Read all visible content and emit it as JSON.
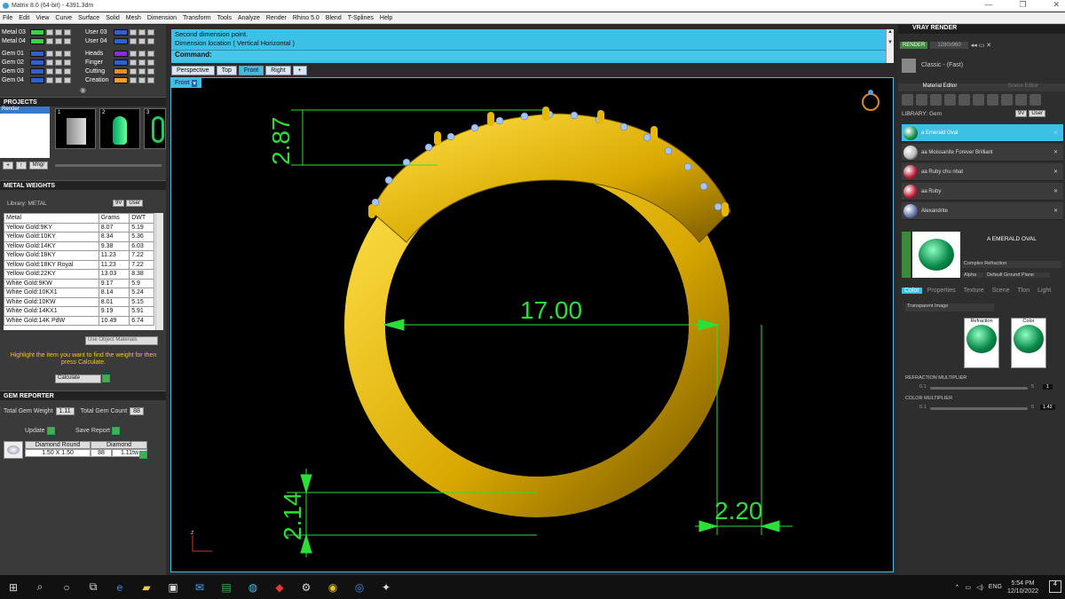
{
  "window": {
    "title": "Matrix 8.0 (64-bit) - 4391.3dm",
    "controls": [
      "—",
      "❐",
      "✕"
    ]
  },
  "menu": [
    "File",
    "Edit",
    "View",
    "Curve",
    "Surface",
    "Solid",
    "Mesh",
    "Dimension",
    "Transform",
    "Tools",
    "Analyze",
    "Render",
    "Rhino 5.0",
    "Blend",
    "T-Splines",
    "Help"
  ],
  "layers": {
    "left": [
      {
        "name": "Metal 03",
        "color": "#3ccf4e"
      },
      {
        "name": "Metal 04",
        "color": "#3ccf4e"
      },
      {
        "name": "Gem 01",
        "color": "#2f5fd0"
      },
      {
        "name": "Gem 02",
        "color": "#2f5fd0"
      },
      {
        "name": "Gem 03",
        "color": "#2f5fd0"
      },
      {
        "name": "Gem 04",
        "color": "#2f5fd0"
      }
    ],
    "right": [
      {
        "name": "User 03",
        "color": "#2f5fd0"
      },
      {
        "name": "User 04",
        "color": "#2f5fd0"
      },
      {
        "name": "Heads",
        "color": "#8a2be2"
      },
      {
        "name": "Finger",
        "color": "#2f5fd0"
      },
      {
        "name": "Cutting",
        "color": "#f08a1c"
      },
      {
        "name": "Creation",
        "color": "#f0a020"
      }
    ]
  },
  "projects": {
    "header": "PROJECTS",
    "list": [
      "Render"
    ],
    "thumb_numbers": [
      "1",
      "2",
      "3"
    ],
    "mngr": "Mngr"
  },
  "metal_weights": {
    "header": "METAL WEIGHTS",
    "library": "Library: METAL",
    "btn_9v": "9V",
    "btn_user": "User",
    "columns": [
      "Metal",
      "Grams",
      "DWT"
    ],
    "rows": [
      [
        "Yellow Gold:9KY",
        "8.07",
        "5.19"
      ],
      [
        "Yellow Gold:10KY",
        "8.34",
        "5.36"
      ],
      [
        "Yellow Gold:14KY",
        "9.38",
        "6.03"
      ],
      [
        "Yellow Gold:18KY",
        "11.23",
        "7.22"
      ],
      [
        "Yellow Gold:18KY Royal",
        "11.23",
        "7.22"
      ],
      [
        "Yellow Gold:22KY",
        "13.03",
        "8.38"
      ],
      [
        "White Gold:9KW",
        "9.17",
        "5.9"
      ],
      [
        "White Gold:10KX1",
        "8.14",
        "5.24"
      ],
      [
        "White Gold:10KW",
        "8.01",
        "5.15"
      ],
      [
        "White Gold:14KX1",
        "9.19",
        "5.91"
      ],
      [
        "White Gold:14K PdW",
        "10.49",
        "6.74"
      ]
    ],
    "use_object": "Use Object Materials",
    "hint": "Highlight the item you want to find the weight for then press Calculate.",
    "calc": "Calculate"
  },
  "gem_reporter": {
    "header": "GEM REPORTER",
    "total_weight_label": "Total Gem Weight",
    "total_weight": "1.11",
    "total_count_label": "Total Gem Count",
    "total_count": "88",
    "update": "Update",
    "save": "Save Report",
    "columns": [
      "Diamond Round",
      "Diamond"
    ],
    "row": [
      "1.50 X 1.50",
      "88",
      "1.11tw"
    ]
  },
  "command": {
    "line1": "Second dimension point.",
    "line2": "Dimension location ( Vertical  Horizontal )",
    "prompt": "Command:"
  },
  "viewport_tabs": [
    "Perspective",
    "Top",
    "Front",
    "Right",
    "+"
  ],
  "viewport_label": "Front",
  "dimensions": {
    "top_left": "2.87",
    "center": "17.00",
    "bottom_left": "2.14",
    "bottom_right": "2.20"
  },
  "axis_label": "z",
  "vray": {
    "header": "VRAY RENDER",
    "render": "RENDER",
    "resolution": "1280x960",
    "quality": "Classic - (Fast)",
    "tabs": [
      "Material Editor",
      "Scene Editor"
    ],
    "library_label": "LIBRARY: Gem",
    "lib_btns": [
      "9V",
      "User"
    ],
    "materials": [
      {
        "name": "a Emerald Oval",
        "color": "#1a9a5a",
        "sel": true
      },
      {
        "name": "aa Moissanite Forever Brilliant",
        "color": "#bbb"
      },
      {
        "name": "aa Ruby chu nhat",
        "color": "#c0203a"
      },
      {
        "name": "aa Ruby",
        "color": "#c0203a"
      },
      {
        "name": "Alexandrite",
        "color": "#6a7ab0"
      }
    ],
    "preview_name": "A EMERALD OVAL",
    "complex": "Complex Refraction",
    "alpha": "Alpha",
    "ground": "Default Ground Plane",
    "subtabs": [
      "Color",
      "Properties",
      "Texture",
      "Scene",
      "Tlon",
      "Light"
    ],
    "transparent": "Transparent Image",
    "swatches": [
      "Refraction",
      "Color"
    ],
    "refr_mult_label": "REFRACTION MULTIPLIER",
    "refr_min": "0.1",
    "refr_max": "5",
    "refr_val": "1",
    "color_mult_label": "COLOR MULTIPLIER",
    "col_min": "0.1",
    "col_max": "5",
    "col_val": "1.42"
  },
  "tray": {
    "lang": "ENG",
    "time": "5:54 PM",
    "date": "12/10/2022",
    "notif": "4"
  }
}
